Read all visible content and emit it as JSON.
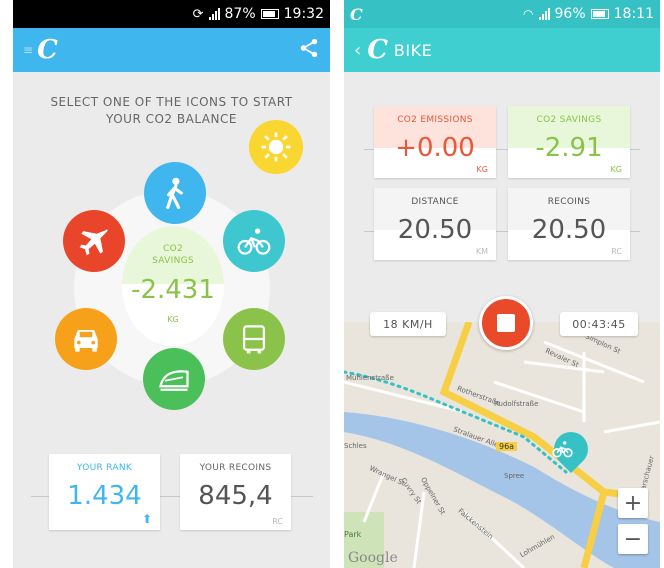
{
  "left_phone": {
    "status": {
      "battery": "87%",
      "time": "19:32"
    },
    "appbar": {
      "logo": "C"
    },
    "instruction_line1": "SELECT ONE OF THE ICONS TO START",
    "instruction_line2": "YOUR CO2 BALANCE",
    "center": {
      "label_line1": "CO2",
      "label_line2": "SAVINGS",
      "value": "-2.431",
      "unit": "KG"
    },
    "transport_icons": [
      "walk-icon",
      "bike-icon",
      "bus-icon",
      "train-icon",
      "car-icon",
      "plane-icon",
      "sun-icon"
    ],
    "colors": {
      "walk": "#3fb6ee",
      "bike": "#3fc7d0",
      "bus": "#8bc34a",
      "train": "#4bbf5a",
      "car": "#f7a11a",
      "plane": "#e8452a",
      "sun": "#f9d630",
      "accent": "#3fb6ee"
    },
    "rank": {
      "label": "YOUR RANK",
      "value": "1.434"
    },
    "recoins": {
      "label": "YOUR RECOINS",
      "value": "845,4",
      "unit": "RC"
    }
  },
  "right_phone": {
    "status": {
      "battery": "96%",
      "time": "18:11"
    },
    "appbar": {
      "logo": "C",
      "title": "BIKE"
    },
    "emissions": {
      "label": "CO2 EMISSIONS",
      "value": "+0.00",
      "unit": "KG"
    },
    "savings": {
      "label": "CO2 SAVINGS",
      "value": "-2.91",
      "unit": "KG"
    },
    "distance": {
      "label": "DISTANCE",
      "value": "20.50",
      "unit": "KM"
    },
    "recoins": {
      "label": "RECOINS",
      "value": "20.50",
      "unit": "RC"
    },
    "speed": "18 KM/H",
    "elapsed": "00:43:45",
    "map": {
      "streets": [
        "Mühlenstraße",
        "Rotherstraße",
        "Rudolfstraße",
        "Stralauer Allee",
        "Revaler St",
        "Simplon St",
        "Warschauer",
        "Wrangel St",
        "Cuvry St",
        "Falckenstein",
        "Oppelner St",
        "Schles",
        "Lohmühlen",
        "Spree",
        "Park"
      ],
      "route_label": "96a",
      "zoom_in": "+",
      "zoom_out": "−",
      "attribution": "Google"
    },
    "colors": {
      "emissions": "#e8583a",
      "savings": "#8bc34a",
      "appbar": "#3fcfd0",
      "stop": "#e84a2a"
    }
  }
}
